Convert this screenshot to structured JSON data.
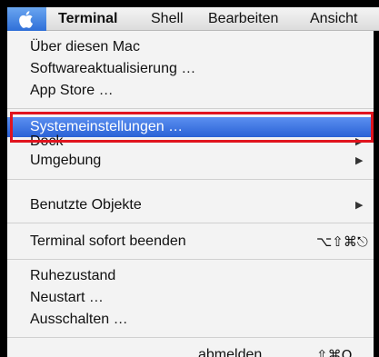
{
  "menubar": {
    "apple_icon": "apple-logo-icon",
    "items": [
      {
        "label": "Terminal"
      },
      {
        "label": "Shell"
      },
      {
        "label": "Bearbeiten"
      },
      {
        "label": "Ansicht"
      }
    ]
  },
  "menu": {
    "items": [
      {
        "label": "Über diesen Mac"
      },
      {
        "label": "Softwareaktualisierung …"
      },
      {
        "label": "App Store …"
      },
      {
        "label": "Systemeinstellungen …"
      },
      {
        "label": "Dock"
      },
      {
        "label": "Umgebung"
      },
      {
        "label": "Benutzte Objekte"
      },
      {
        "label": "Terminal sofort beenden",
        "shortcut": "⌥⇧⌘⎋"
      },
      {
        "label": "Ruhezustand"
      },
      {
        "label": "Neustart …"
      },
      {
        "label": "Ausschalten …"
      },
      {
        "label": "abmelden",
        "shortcut": "⇧⌘Q"
      }
    ],
    "submenu_arrow": "▶"
  },
  "colors": {
    "highlight": "#2a62d6",
    "annotation_box": "#e0141e",
    "menu_background": "#f3f3f3"
  }
}
